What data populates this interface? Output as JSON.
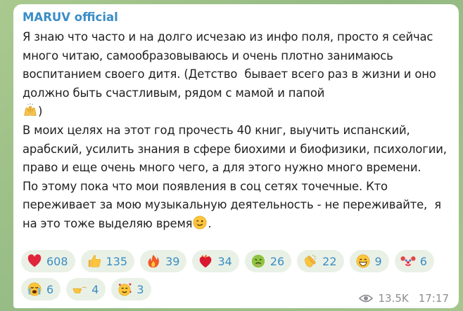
{
  "message": {
    "author": "MARUV official",
    "paragraph_1": "Я знаю что часто и на долго исчезаю из инфо поля, просто я сейчас много читаю, самообразовываюсь и очень плотно занимаюсь воспитанием своего дитя. (Детство  бывает всего раз в жизни и оно должно быть счастливым, рядом с мамой и папой",
    "paragraph_1_end": ")",
    "paragraph_2": "В моих целях на этот год прочесть 40 книг, выучить испанский, арабский, усилить знания в сфере биохими и биофизики, психологии, право и еще очень много чего, а для этого нужно много времени.",
    "paragraph_3": "По этому пока что мои появления в соц сетях точечные. Кто переживает за мою музыкальную деятельность - не переживайте,  я на это тоже выделяю время",
    "paragraph_3_end": ".",
    "inline_emoji_1": "raising-hands-icon",
    "inline_emoji_2": "winking-face-icon"
  },
  "reactions": [
    {
      "icon": "red-heart-icon",
      "count": "608"
    },
    {
      "icon": "thumbs-up-icon",
      "count": "135"
    },
    {
      "icon": "fire-icon",
      "count": "39"
    },
    {
      "icon": "heart-on-fire-icon",
      "count": "34"
    },
    {
      "icon": "nauseated-face-icon",
      "count": "26"
    },
    {
      "icon": "clapping-hands-icon",
      "count": "22"
    },
    {
      "icon": "grinning-face-icon",
      "count": "9"
    },
    {
      "icon": "clown-face-icon",
      "count": "6"
    },
    {
      "icon": "crying-face-icon",
      "count": "6"
    },
    {
      "icon": "pointing-hand-icon",
      "count": "4"
    },
    {
      "icon": "smiling-face-with-hearts-icon",
      "count": "3"
    }
  ],
  "meta": {
    "views": "13.5K",
    "time": "17:17",
    "views_icon": "eye-icon"
  },
  "colors": {
    "author": "#3a8dc6",
    "count": "#3a8dc6",
    "reaction_bg": "#e9f1e6",
    "meta": "#8e8e93"
  }
}
